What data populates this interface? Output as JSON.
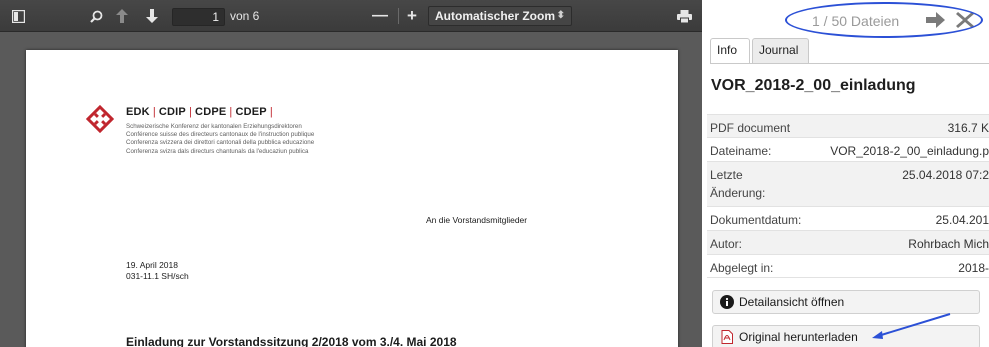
{
  "toolbar": {
    "sidebar_toggle_icon": "sidebar-icon",
    "search_icon": "search-icon",
    "prev_icon": "arrow-up-icon",
    "next_icon": "arrow-down-icon",
    "page_number": "1",
    "page_of": "von 6",
    "zoom_out_label": "—",
    "zoom_in_label": "+",
    "zoom_value": "Automatischer Zoom",
    "zoom_caret": "⬍",
    "print_icon": "print-icon"
  },
  "document": {
    "org_names": [
      "EDK",
      "CDIP",
      "CDPE",
      "CDEP"
    ],
    "org_separator": "|",
    "org_lines": [
      "Schweizerische Konferenz der kantonalen Erziehungsdirektoren",
      "Conférence suisse des directeurs cantonaux de l'instruction publique",
      "Conferenza svizzera dei direttori cantonali della pubblica educazione",
      "Conferenza svizra dals directurs chantunals da l'educaziun publica"
    ],
    "recipient": "An die Vorstandsmitglieder",
    "date": "19. April 2018",
    "reference": "031-11.1 SH/sch",
    "heading": "Einladung zur Vorstandssitzung 2/2018 vom 3./4. Mai 2018",
    "logo_color": "#c0262e"
  },
  "panel": {
    "file_count": "1 / 50 Dateien",
    "next_icon": "arrow-right-icon",
    "close_icon": "close-icon",
    "tabs": [
      {
        "label": "Info",
        "active": true
      },
      {
        "label": "Journal",
        "active": false
      }
    ],
    "file_title": "VOR_2018-2_00_einladung",
    "meta": [
      {
        "label": "PDF document",
        "value": "316.7 K"
      },
      {
        "label": "Dateiname:",
        "value": "VOR_2018-2_00_einladung.p"
      },
      {
        "label": "Letzte Änderung:",
        "value": "25.04.2018 07:2"
      },
      {
        "label": "Dokumentdatum:",
        "value": "25.04.201"
      },
      {
        "label": "Autor:",
        "value": "Rohrbach Mich"
      },
      {
        "label": "Abgelegt in:",
        "value": "2018-"
      }
    ],
    "detail_button": "Detailansicht öffnen",
    "download_button": "Original herunterladen",
    "annotation_color": "#2b50d6"
  }
}
